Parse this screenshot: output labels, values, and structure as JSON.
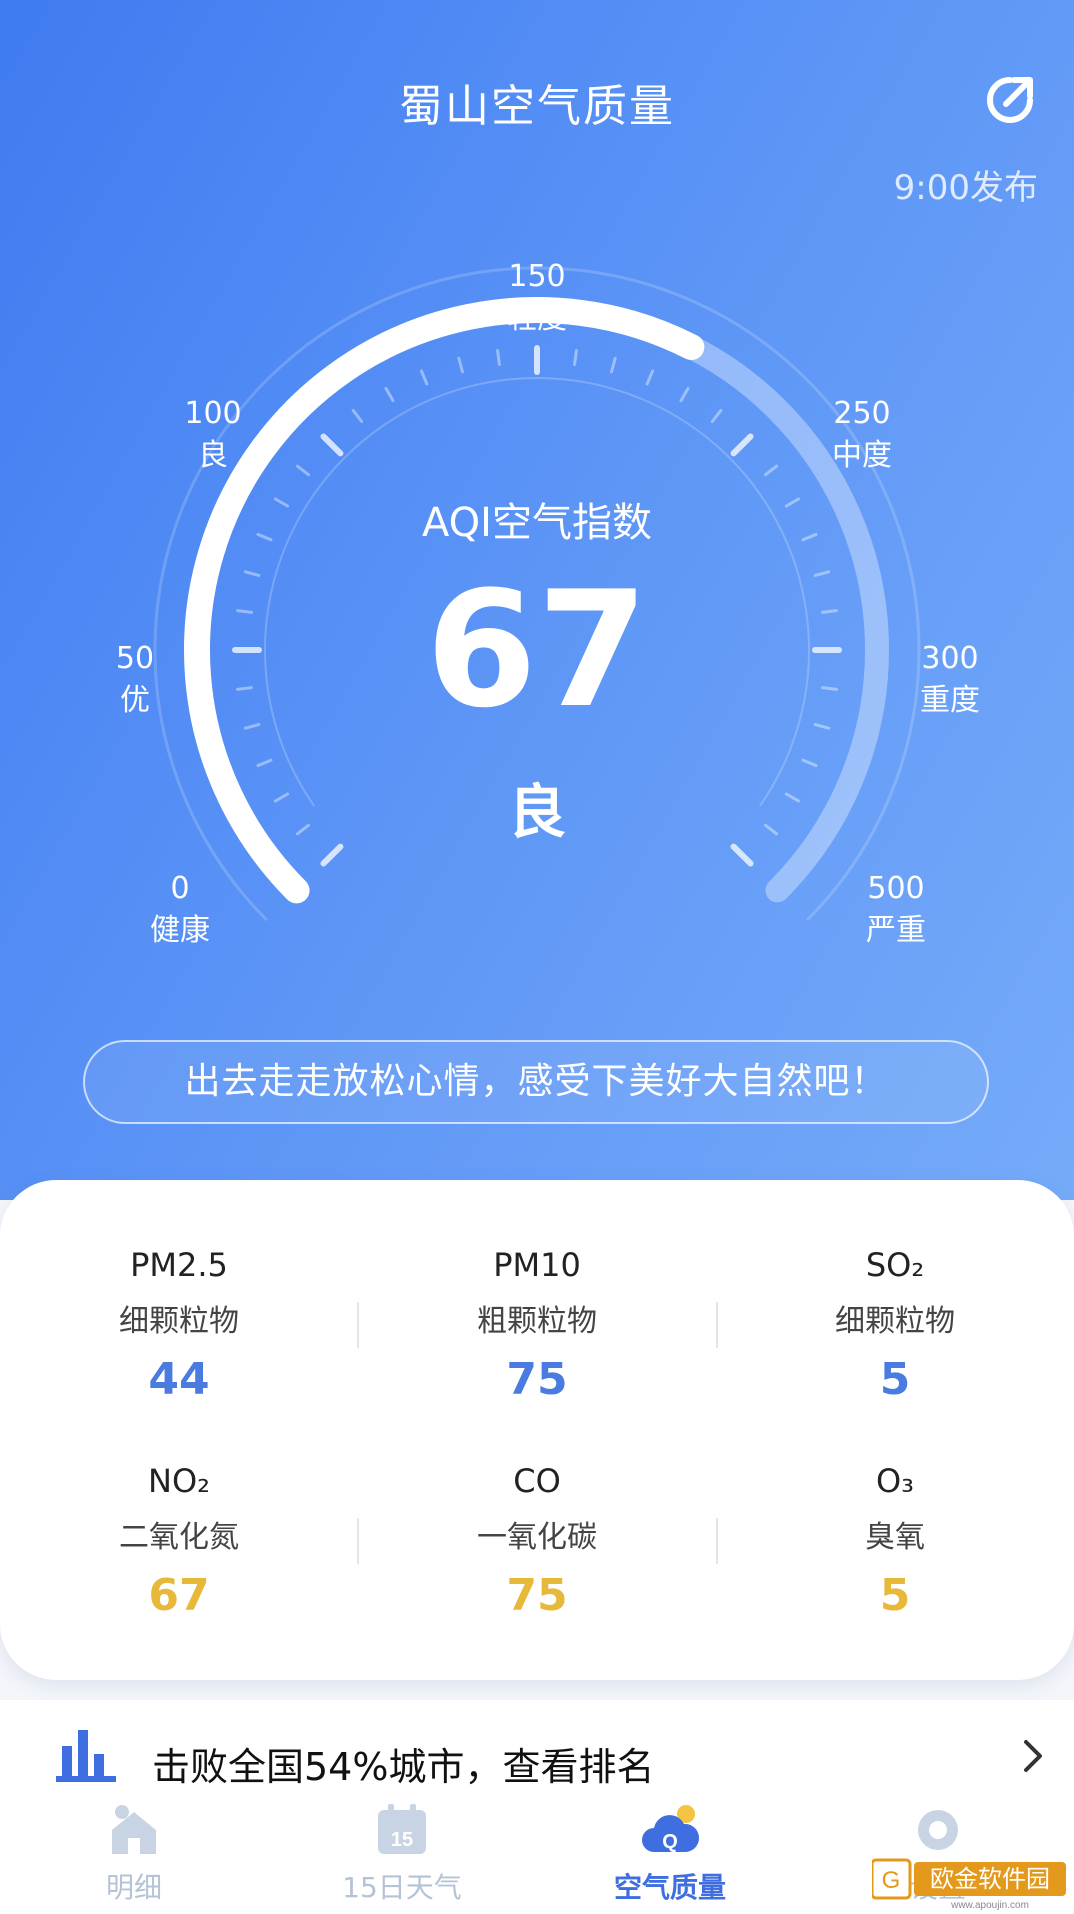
{
  "header": {
    "title": "蜀山空气质量",
    "publish_time": "9:00发布"
  },
  "gauge": {
    "aqi_title": "AQI空气指数",
    "aqi_value": "67",
    "aqi_level": "良",
    "progress_fraction": 0.6,
    "labels": [
      {
        "value": "0",
        "level": "健康"
      },
      {
        "value": "50",
        "level": "优"
      },
      {
        "value": "100",
        "level": "良"
      },
      {
        "value": "150",
        "level": "轻度"
      },
      {
        "value": "250",
        "level": "中度"
      },
      {
        "value": "300",
        "level": "重度"
      },
      {
        "value": "500",
        "level": "严重"
      }
    ]
  },
  "tip": "出去走走放松心情，感受下美好大自然吧！",
  "pollutants": [
    {
      "code": "PM2.5",
      "name": "细颗粒物",
      "value": "44"
    },
    {
      "code": "PM10",
      "name": "粗颗粒物",
      "value": "75"
    },
    {
      "code": "SO₂",
      "name": "细颗粒物",
      "value": "5"
    },
    {
      "code": "NO₂",
      "name": "二氧化氮",
      "value": "67"
    },
    {
      "code": "CO",
      "name": "一氧化碳",
      "value": "75"
    },
    {
      "code": "O₃",
      "name": "臭氧",
      "value": "5"
    }
  ],
  "rank": {
    "text": "击败全国54%城市，查看排名"
  },
  "tabs": [
    {
      "label": "明细",
      "icon": "home-icon"
    },
    {
      "label": "15日天气",
      "icon": "calendar-icon"
    },
    {
      "label": "空气质量",
      "icon": "air-quality-icon"
    },
    {
      "label": "设置",
      "icon": "gear-icon"
    }
  ],
  "watermark": {
    "text": "欧金软件园",
    "url": "www.apoujin.com"
  },
  "colors": {
    "accent_blue": "#4a7be0",
    "accent_yellow": "#e8b838",
    "active_tab": "#3f6ee0"
  }
}
